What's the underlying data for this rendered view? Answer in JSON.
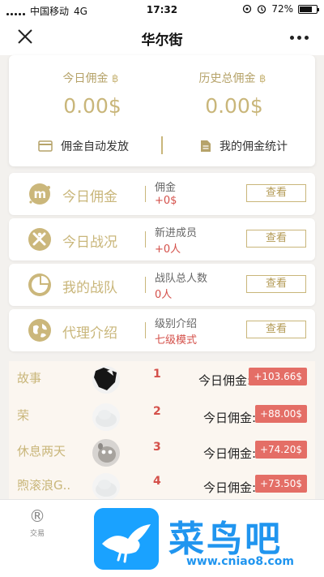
{
  "status_bar": {
    "carrier": "中国移动",
    "network": "4G",
    "time": "17:32",
    "battery": "72%"
  },
  "nav": {
    "title": "华尔街"
  },
  "summary": {
    "today": {
      "label": "今日佣金",
      "value": "0.00$"
    },
    "total": {
      "label": "历史总佣金",
      "value": "0.00$"
    },
    "actions": {
      "auto": "佣金自动发放",
      "stats": "我的佣金统计"
    }
  },
  "rows": [
    {
      "title": "今日佣金",
      "label": "佣金",
      "value": "+0$",
      "button": "查看",
      "icon": "m-coin-icon"
    },
    {
      "title": "今日战况",
      "label": "新进成员",
      "value": "+0人",
      "button": "查看",
      "icon": "sword-icon"
    },
    {
      "title": "我的战队",
      "label": "战队总人数",
      "value": "0人",
      "button": "查看",
      "icon": "pie-chart-icon"
    },
    {
      "title": "代理介绍",
      "label": "级别介绍",
      "value": "七级模式",
      "button": "查看",
      "icon": "globe-icon"
    }
  ],
  "ranking": [
    {
      "name": "故事",
      "rank": "1",
      "label": "今日佣金:",
      "amount": "+103.66$"
    },
    {
      "name": "荣",
      "rank": "2",
      "label": "今日佣金:",
      "amount": "+88.00$"
    },
    {
      "name": "休息两天",
      "rank": "3",
      "label": "今日佣金:",
      "amount": "+74.20$"
    },
    {
      "name": "煦滚浪G..",
      "rank": "4",
      "label": "今日佣金:",
      "amount": "+73.50$"
    }
  ],
  "tab_bar": {
    "item": {
      "icon": "®",
      "label": "交易"
    }
  },
  "watermark": {
    "title": "菜鸟吧",
    "url": "www.cniao8.com"
  },
  "colors": {
    "gold": "#c9b67a",
    "red": "#d4504a",
    "badge": "#e46e66"
  }
}
